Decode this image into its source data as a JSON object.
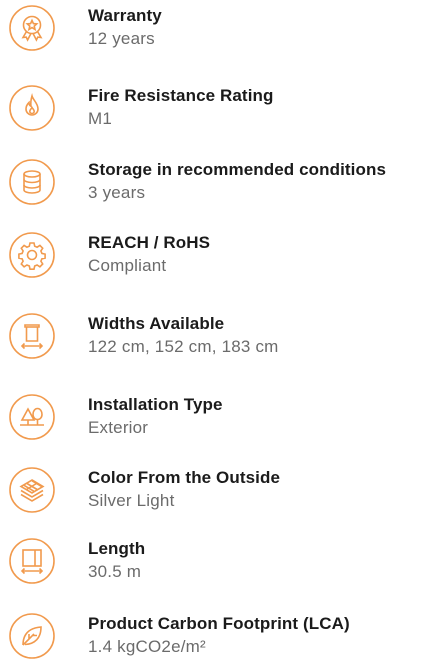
{
  "accent_color": "#f19a4d",
  "specs": [
    {
      "label": "Warranty",
      "value": "12 years",
      "icon": "warranty-badge-icon"
    },
    {
      "label": "Fire Resistance Rating",
      "value": "M1",
      "icon": "flame-icon"
    },
    {
      "label": "Storage in recommended conditions",
      "value": "3 years",
      "icon": "database-storage-icon"
    },
    {
      "label": "REACH / RoHS",
      "value": "Compliant",
      "icon": "gear-icon"
    },
    {
      "label": "Widths Available",
      "value": "122 cm, 152 cm, 183 cm",
      "icon": "roll-width-icon"
    },
    {
      "label": "Installation Type",
      "value": "Exterior",
      "icon": "outdoor-trees-icon"
    },
    {
      "label": "Color From the Outside",
      "value": "Silver Light",
      "icon": "layers-icon"
    },
    {
      "label": "Length",
      "value": "30.5 m",
      "icon": "length-icon"
    },
    {
      "label": "Product Carbon Footprint (LCA)",
      "value": "1.4 kgCO2e/m²",
      "icon": "leaf-icon"
    }
  ]
}
